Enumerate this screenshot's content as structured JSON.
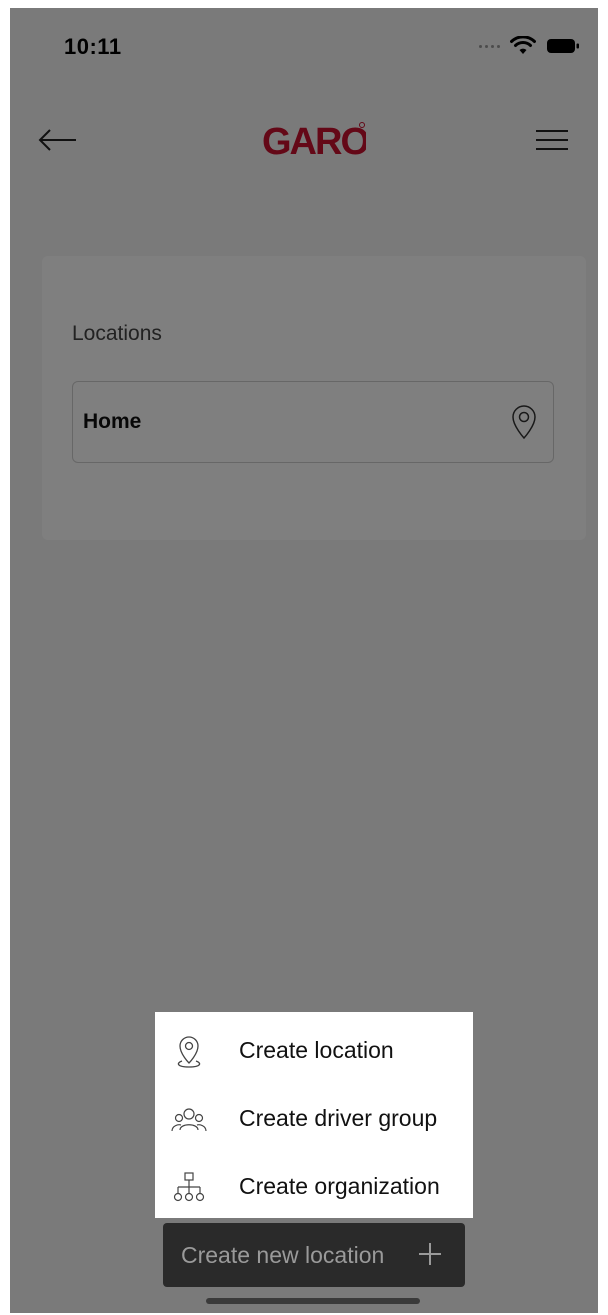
{
  "status_bar": {
    "time": "10:11",
    "icons": [
      "signal-dots-icon",
      "wifi-icon",
      "battery-icon"
    ]
  },
  "header": {
    "logo_text": "GARO",
    "back_icon": "arrow-left-icon",
    "menu_icon": "hamburger-menu-icon"
  },
  "locations": {
    "title": "Locations",
    "items": [
      {
        "name": "Home",
        "icon": "location-pin-icon"
      }
    ]
  },
  "popup_menu": {
    "items": [
      {
        "label": "Create location",
        "icon": "location-pin-icon"
      },
      {
        "label": "Create driver group",
        "icon": "people-group-icon"
      },
      {
        "label": "Create organization",
        "icon": "org-chart-icon"
      }
    ]
  },
  "create_button": {
    "label": "Create new location",
    "icon": "plus-icon"
  },
  "colors": {
    "brand": "#c8102e",
    "overlay": "rgba(0,0,0,0.5)",
    "button_bg": "#2a2a2a"
  }
}
